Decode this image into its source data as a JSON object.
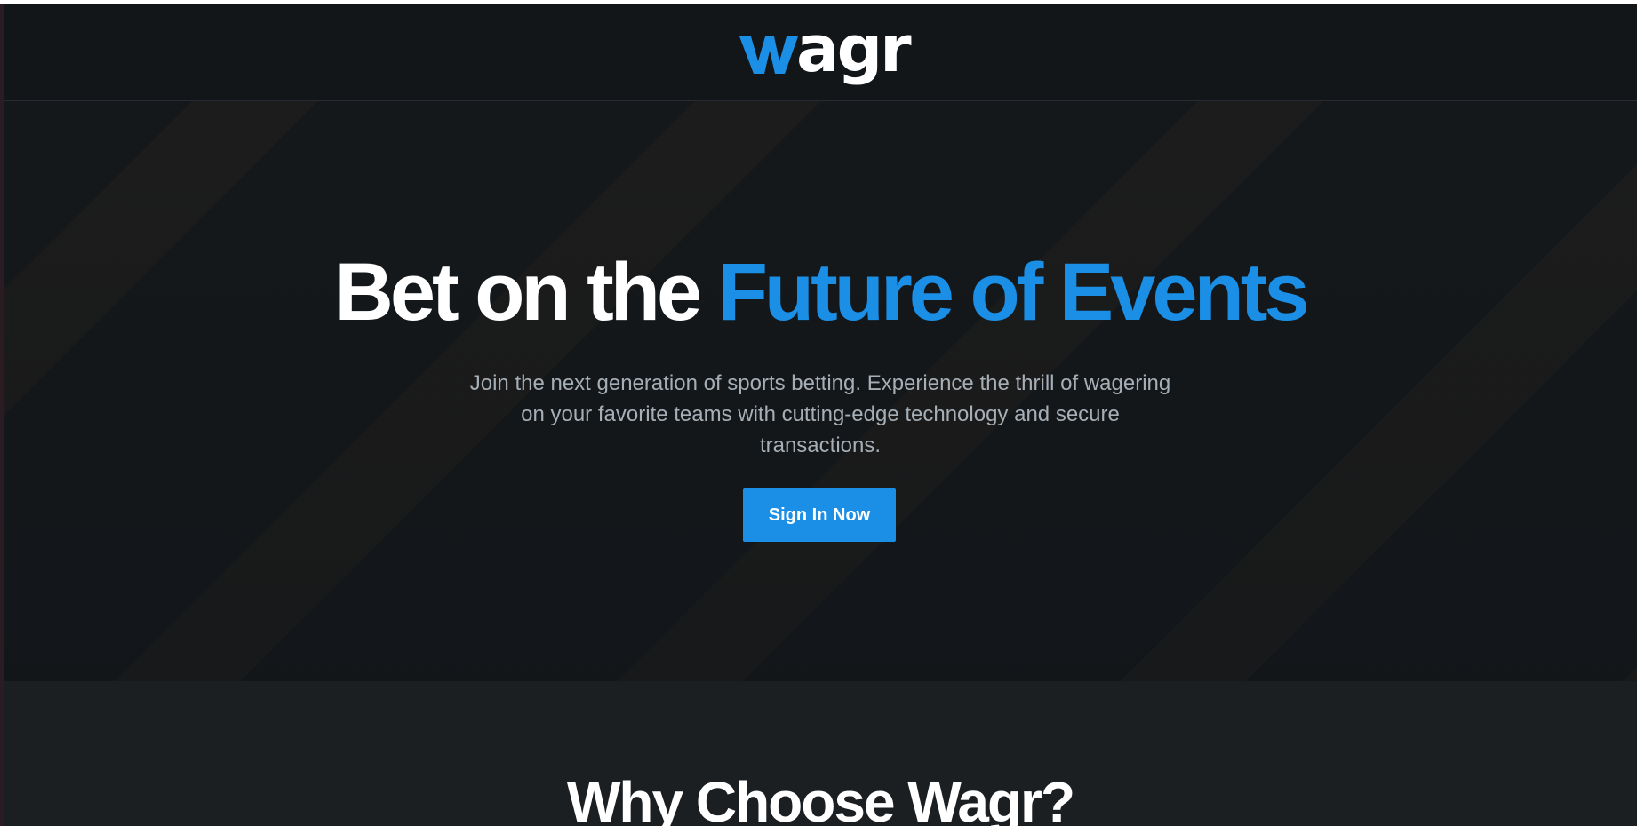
{
  "header": {
    "logo": {
      "mark": "w",
      "text": "agr",
      "mark_color": "#1b8fe6"
    }
  },
  "hero": {
    "title_part1": "Bet on the",
    "title_part2": "Future of Events",
    "subtitle": "Join the next generation of sports betting. Experience the thrill of wagering on your favorite teams with cutting-edge technology and secure transactions.",
    "cta_label": "Sign In Now"
  },
  "why_section": {
    "title": "Why Choose Wagr?"
  },
  "colors": {
    "accent": "#1b8fe6",
    "header_bg": "#121619",
    "hero_bg": "#14181b",
    "section_bg": "#1b1f22",
    "stripe_tint": "#ff8c32"
  }
}
